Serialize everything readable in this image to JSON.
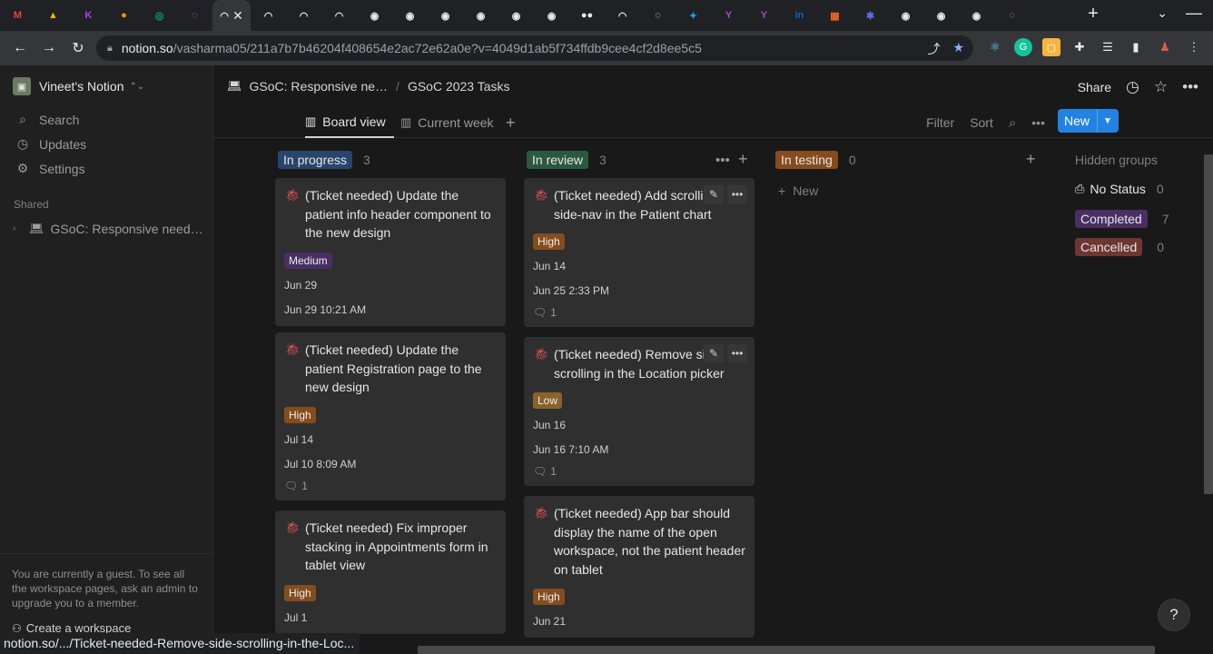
{
  "browser": {
    "tabs": [
      {
        "icon": "gmail-icon",
        "glyph": "M",
        "color": "#ea4335"
      },
      {
        "icon": "drive-icon",
        "glyph": "▲",
        "color": "#f4b400"
      },
      {
        "icon": "k-app-icon",
        "glyph": "K",
        "color": "#b23cff"
      },
      {
        "icon": "tab-app-icon",
        "glyph": "●",
        "color": "#f29900"
      },
      {
        "icon": "chatgpt-icon",
        "glyph": "◎",
        "color": "#10a37f"
      },
      {
        "icon": "ring-icon",
        "glyph": "◌",
        "color": "#e05ac4"
      },
      {
        "icon": "loading-icon",
        "glyph": "◠",
        "color": "#e8eaed"
      },
      {
        "icon": "loading-icon",
        "glyph": "◠",
        "color": "#e8eaed"
      },
      {
        "icon": "loading-icon",
        "glyph": "◠",
        "color": "#e8eaed"
      },
      {
        "icon": "loading-icon",
        "glyph": "◠",
        "color": "#e8eaed"
      },
      {
        "icon": "github-icon",
        "glyph": "◉",
        "color": "#e8eaed"
      },
      {
        "icon": "github-icon",
        "glyph": "◉",
        "color": "#e8eaed"
      },
      {
        "icon": "github-icon",
        "glyph": "◉",
        "color": "#e8eaed"
      },
      {
        "icon": "github-icon",
        "glyph": "◉",
        "color": "#e8eaed"
      },
      {
        "icon": "github-icon",
        "glyph": "◉",
        "color": "#e8eaed"
      },
      {
        "icon": "github-icon",
        "glyph": "◉",
        "color": "#e8eaed"
      },
      {
        "icon": "medium-icon",
        "glyph": "●●",
        "color": "#e8eaed"
      },
      {
        "icon": "loading-icon",
        "glyph": "◠",
        "color": "#e8eaed"
      },
      {
        "icon": "blocked-icon",
        "glyph": "◌",
        "color": "#e8eaed"
      },
      {
        "icon": "twitter-icon",
        "glyph": "✦",
        "color": "#1d9bf0"
      },
      {
        "icon": "yahoo-icon",
        "glyph": "Y",
        "color": "#9b4dca"
      },
      {
        "icon": "yahoo-icon",
        "glyph": "Y",
        "color": "#9b4dca"
      },
      {
        "icon": "linkedin-icon",
        "glyph": "in",
        "color": "#0a66c2"
      },
      {
        "icon": "grid-app-icon",
        "glyph": "▦",
        "color": "#f26522"
      },
      {
        "icon": "gear-app-icon",
        "glyph": "✱",
        "color": "#5b6ee1"
      },
      {
        "icon": "github-icon",
        "glyph": "◉",
        "color": "#e8eaed"
      },
      {
        "icon": "github-icon",
        "glyph": "◉",
        "color": "#e8eaed"
      },
      {
        "icon": "github-icon",
        "glyph": "◉",
        "color": "#e8eaed"
      },
      {
        "icon": "colorful-icon",
        "glyph": "◌",
        "color": "#e8a03c"
      }
    ],
    "url_host": "notion.so",
    "url_path": "/vasharma05/211a7b7b46204f408654e2ac72e62a0e?v=4049d1ab5f734ffdb9cee4cf2d8ee5c5",
    "status_text": "notion.so/.../Ticket-needed-Remove-side-scrolling-in-the-Loc..."
  },
  "sidebar": {
    "workspace_name": "Vineet's Notion",
    "items": [
      {
        "icon": "search-icon",
        "glyph": "⌕",
        "label": "Search"
      },
      {
        "icon": "clock-icon",
        "glyph": "◷",
        "label": "Updates"
      },
      {
        "icon": "gear-icon",
        "glyph": "⚙",
        "label": "Settings"
      }
    ],
    "shared_label": "Shared",
    "shared_page": "GSoC: Responsive need…",
    "guest_notice": "You are currently a guest. To see all the workspace pages, ask an admin to upgrade you to a member.",
    "create_workspace": "Create a workspace"
  },
  "topbar": {
    "crumb1": "GSoC: Responsive ne…",
    "crumb2": "GSoC 2023 Tasks",
    "share": "Share"
  },
  "views": {
    "board": "Board view",
    "current_week": "Current week",
    "filter": "Filter",
    "sort": "Sort",
    "new": "New"
  },
  "columns": [
    {
      "name": "In progress",
      "count": "3",
      "color": "#28456c",
      "cards": [
        {
          "title": "(Ticket needed) Update the patient info header component to the new design",
          "priority": "Medium",
          "priority_color": "#492f64",
          "date1": "Jun 29",
          "date2": "Jun 29 10:21 AM",
          "comments": ""
        },
        {
          "title": "(Ticket needed) Update the patient Registration page to the new design",
          "priority": "High",
          "priority_color": "#854c1d",
          "date1": "Jul 14",
          "date2": "Jul 10 8:09 AM",
          "comments": "1"
        },
        {
          "title": "(Ticket needed) Fix improper stacking in Appointments form in tablet view",
          "priority": "High",
          "priority_color": "#854c1d",
          "date1": "Jul 1",
          "date2": "",
          "comments": ""
        }
      ]
    },
    {
      "name": "In review",
      "count": "3",
      "color": "#2b593f",
      "cards": [
        {
          "title": "(Ticket needed) Add scrolli the side-nav in the Patient chart",
          "priority": "High",
          "priority_color": "#854c1d",
          "date1": "Jun 14",
          "date2": "Jun 25 2:33 PM",
          "comments": "1"
        },
        {
          "title": "(Ticket needed) Remove side scrolling in the Location picker",
          "priority": "Low",
          "priority_color": "#89632a",
          "date1": "Jun 16",
          "date2": "Jun 16 7:10 AM",
          "comments": "1"
        },
        {
          "title": "(Ticket needed) App bar should display the name of the open workspace, not the patient header on tablet",
          "priority": "High",
          "priority_color": "#854c1d",
          "date1": "Jun 21",
          "date2": "",
          "comments": ""
        }
      ]
    },
    {
      "name": "In testing",
      "count": "0",
      "color": "#854c1d",
      "add_new": "New"
    }
  ],
  "hidden_groups": {
    "label": "Hidden groups",
    "groups": [
      {
        "name": "No Status",
        "count": "0",
        "color": ""
      },
      {
        "name": "Completed",
        "count": "7",
        "color": "#492f64"
      },
      {
        "name": "Cancelled",
        "count": "0",
        "color": "#6e3630"
      }
    ]
  },
  "help": "?"
}
